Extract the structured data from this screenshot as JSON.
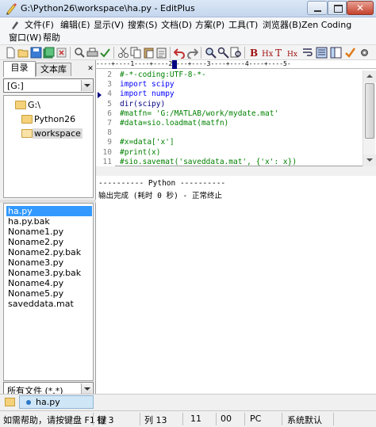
{
  "window": {
    "title": "G:\\Python26\\workspace\\ha.py - EditPlus",
    "close_glyph": "✕"
  },
  "menu": {
    "row1": [
      "文件(F)",
      "编辑(E)",
      "显示(V)",
      "搜索(S)",
      "文档(D)",
      "方案(P)",
      "工具(T)",
      "浏览器(B)",
      "Zen Coding"
    ],
    "row2": [
      "窗口(W)",
      "帮助"
    ]
  },
  "toolbar": {
    "icons": [
      "new-file-icon",
      "open-folder-icon",
      "save-icon",
      "save-all-icon",
      "close-file-icon",
      "print-preview-icon",
      "print-icon",
      "spell-check-icon",
      "cut-icon",
      "copy-icon",
      "paste-icon",
      "clipboard-icon",
      "undo-icon",
      "redo-icon",
      "find-icon",
      "replace-icon",
      "find-in-files-icon",
      "bold-icon",
      "heading-icon",
      "text-icon",
      "hex-icon",
      "word-wrap-icon",
      "column-select-icon",
      "layout-icon",
      "check-icon"
    ]
  },
  "left_panel": {
    "tabs": [
      "目录",
      "文本库"
    ],
    "active_tab": "目录",
    "drive": "[G:]",
    "folders": [
      "G:\\",
      "Python26",
      "workspace"
    ],
    "selected_folder": "workspace",
    "files": [
      "ha.py",
      "ha.py.bak",
      "Noname1.py",
      "Noname2.py",
      "Noname2.py.bak",
      "Noname3.py",
      "Noname3.py.bak",
      "Noname4.py",
      "Noname5.py",
      "saveddata.mat"
    ],
    "selected_file": "ha.py",
    "filter": "所有文件 (*.*)"
  },
  "editor": {
    "ruler": "----+----1----+----2----+----3----+----4----+----5-",
    "lines": [
      {
        "no": "2",
        "text": "#-*-coding:UTF-8-*-",
        "kind": "comment"
      },
      {
        "no": "3",
        "text": "import scipy",
        "kind": "import"
      },
      {
        "no": "4",
        "text": "import numpy",
        "kind": "import"
      },
      {
        "no": "5",
        "text": "dir(scipy)",
        "kind": "plain"
      },
      {
        "no": "6",
        "text": "#matfn= 'G:/MATLAB/work/mydate.mat'",
        "kind": "comment"
      },
      {
        "no": "7",
        "text": "#data=sio.loadmat(matfn)",
        "kind": "comment"
      },
      {
        "no": "8",
        "text": "",
        "kind": "plain"
      },
      {
        "no": "9",
        "text": "#x=data['x']",
        "kind": "comment"
      },
      {
        "no": "10",
        "text": "#print(x)",
        "kind": "comment"
      },
      {
        "no": "11",
        "text": "#sio.savemat('saveddata.mat', {'x': x})",
        "kind": "comment"
      }
    ],
    "keyword_color": "#0000ff",
    "comment_color": "#008000"
  },
  "output": {
    "lines": [
      "---------- Python ----------",
      "输出完成 (耗时 0 秒) - 正常终止"
    ]
  },
  "document_tabs": {
    "items": [
      "ha.py"
    ]
  },
  "status": {
    "help": "如需帮助，请按键盘 F1 键",
    "line": "行 3",
    "col": "列 13",
    "col_count": "11",
    "char_count": "00",
    "eol": "PC",
    "encoding": "系统默认"
  }
}
